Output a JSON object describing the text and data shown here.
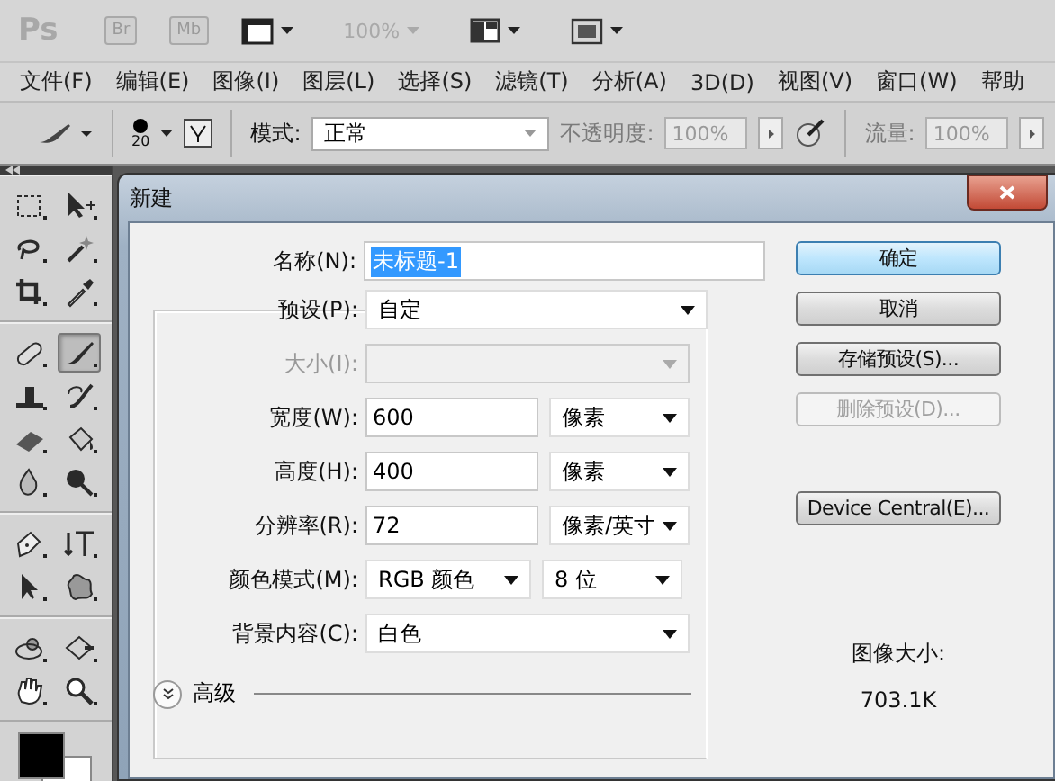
{
  "app_bar": {
    "logo": "Ps",
    "bridge": "Br",
    "mini_bridge": "Mb",
    "zoom": "100%"
  },
  "menu": [
    {
      "label": "文件(F)"
    },
    {
      "label": "编辑(E)"
    },
    {
      "label": "图像(I)"
    },
    {
      "label": "图层(L)"
    },
    {
      "label": "选择(S)"
    },
    {
      "label": "滤镜(T)"
    },
    {
      "label": "分析(A)"
    },
    {
      "label": "3D(D)"
    },
    {
      "label": "视图(V)"
    },
    {
      "label": "窗口(W)"
    },
    {
      "label": "帮助"
    }
  ],
  "options_bar": {
    "brush_size": "20",
    "mode_label": "模式:",
    "mode": "正常",
    "opacity_label": "不透明度:",
    "opacity": "100%",
    "opacity_disabled": true,
    "flow_label": "流量:",
    "flow": "100%",
    "flow_disabled": true
  },
  "tool_groups": [
    [
      {
        "kind": "marquee",
        "selected": false
      },
      {
        "kind": "move",
        "selected": false
      },
      {
        "kind": "lasso",
        "selected": false
      },
      {
        "kind": "wand",
        "selected": false
      },
      {
        "kind": "crop",
        "selected": false
      },
      {
        "kind": "eyedropper",
        "selected": false
      }
    ],
    [
      {
        "kind": "healing",
        "selected": false
      },
      {
        "kind": "brush",
        "selected": true
      },
      {
        "kind": "stamp",
        "selected": false
      },
      {
        "kind": "history",
        "selected": false
      },
      {
        "kind": "eraser",
        "selected": false
      },
      {
        "kind": "bucket",
        "selected": false
      },
      {
        "kind": "blur",
        "selected": false
      },
      {
        "kind": "dodge",
        "selected": false
      }
    ],
    [
      {
        "kind": "pen",
        "selected": false
      },
      {
        "kind": "type",
        "selected": false
      },
      {
        "kind": "path",
        "selected": false
      },
      {
        "kind": "shape",
        "selected": false
      }
    ],
    [
      {
        "kind": "rotate3d",
        "selected": false
      },
      {
        "kind": "orbit3d",
        "selected": false
      },
      {
        "kind": "hand",
        "selected": false
      },
      {
        "kind": "zoom",
        "selected": false
      }
    ]
  ],
  "dialog": {
    "title": "新建",
    "name": {
      "label": "名称(N):",
      "value": "未标题-1",
      "selected": true
    },
    "preset": {
      "label": "预设(P):",
      "value": "自定"
    },
    "rows": [
      {
        "kind": "select",
        "label": "大小(I):",
        "disabled": true
      },
      {
        "kind": "measure",
        "label": "宽度(W):",
        "value": "600",
        "unit": "像素"
      },
      {
        "kind": "measure",
        "label": "高度(H):",
        "value": "400",
        "unit": "像素"
      },
      {
        "kind": "measure",
        "label": "分辨率(R):",
        "value": "72",
        "unit": "像素/英寸"
      },
      {
        "kind": "pair",
        "label": "颜色模式(M):",
        "value": "RGB 颜色",
        "unit": "8 位"
      },
      {
        "kind": "select",
        "label": "背景内容(C):",
        "value": "白色",
        "disabled": false
      }
    ],
    "advanced": "高级",
    "buttons": [
      {
        "label": "确定",
        "focused": true,
        "disabled": false
      },
      {
        "label": "取消",
        "focused": false,
        "disabled": false
      },
      {
        "label": "存储预设(S)...",
        "focused": false,
        "disabled": false
      },
      {
        "label": "删除预设(D)...",
        "focused": false,
        "disabled": true
      }
    ],
    "extra_buttons": [
      {
        "label": "Device Central(E)...",
        "focused": false,
        "disabled": false
      }
    ],
    "image_size_label": "图像大小:",
    "image_size": "703.1K"
  }
}
